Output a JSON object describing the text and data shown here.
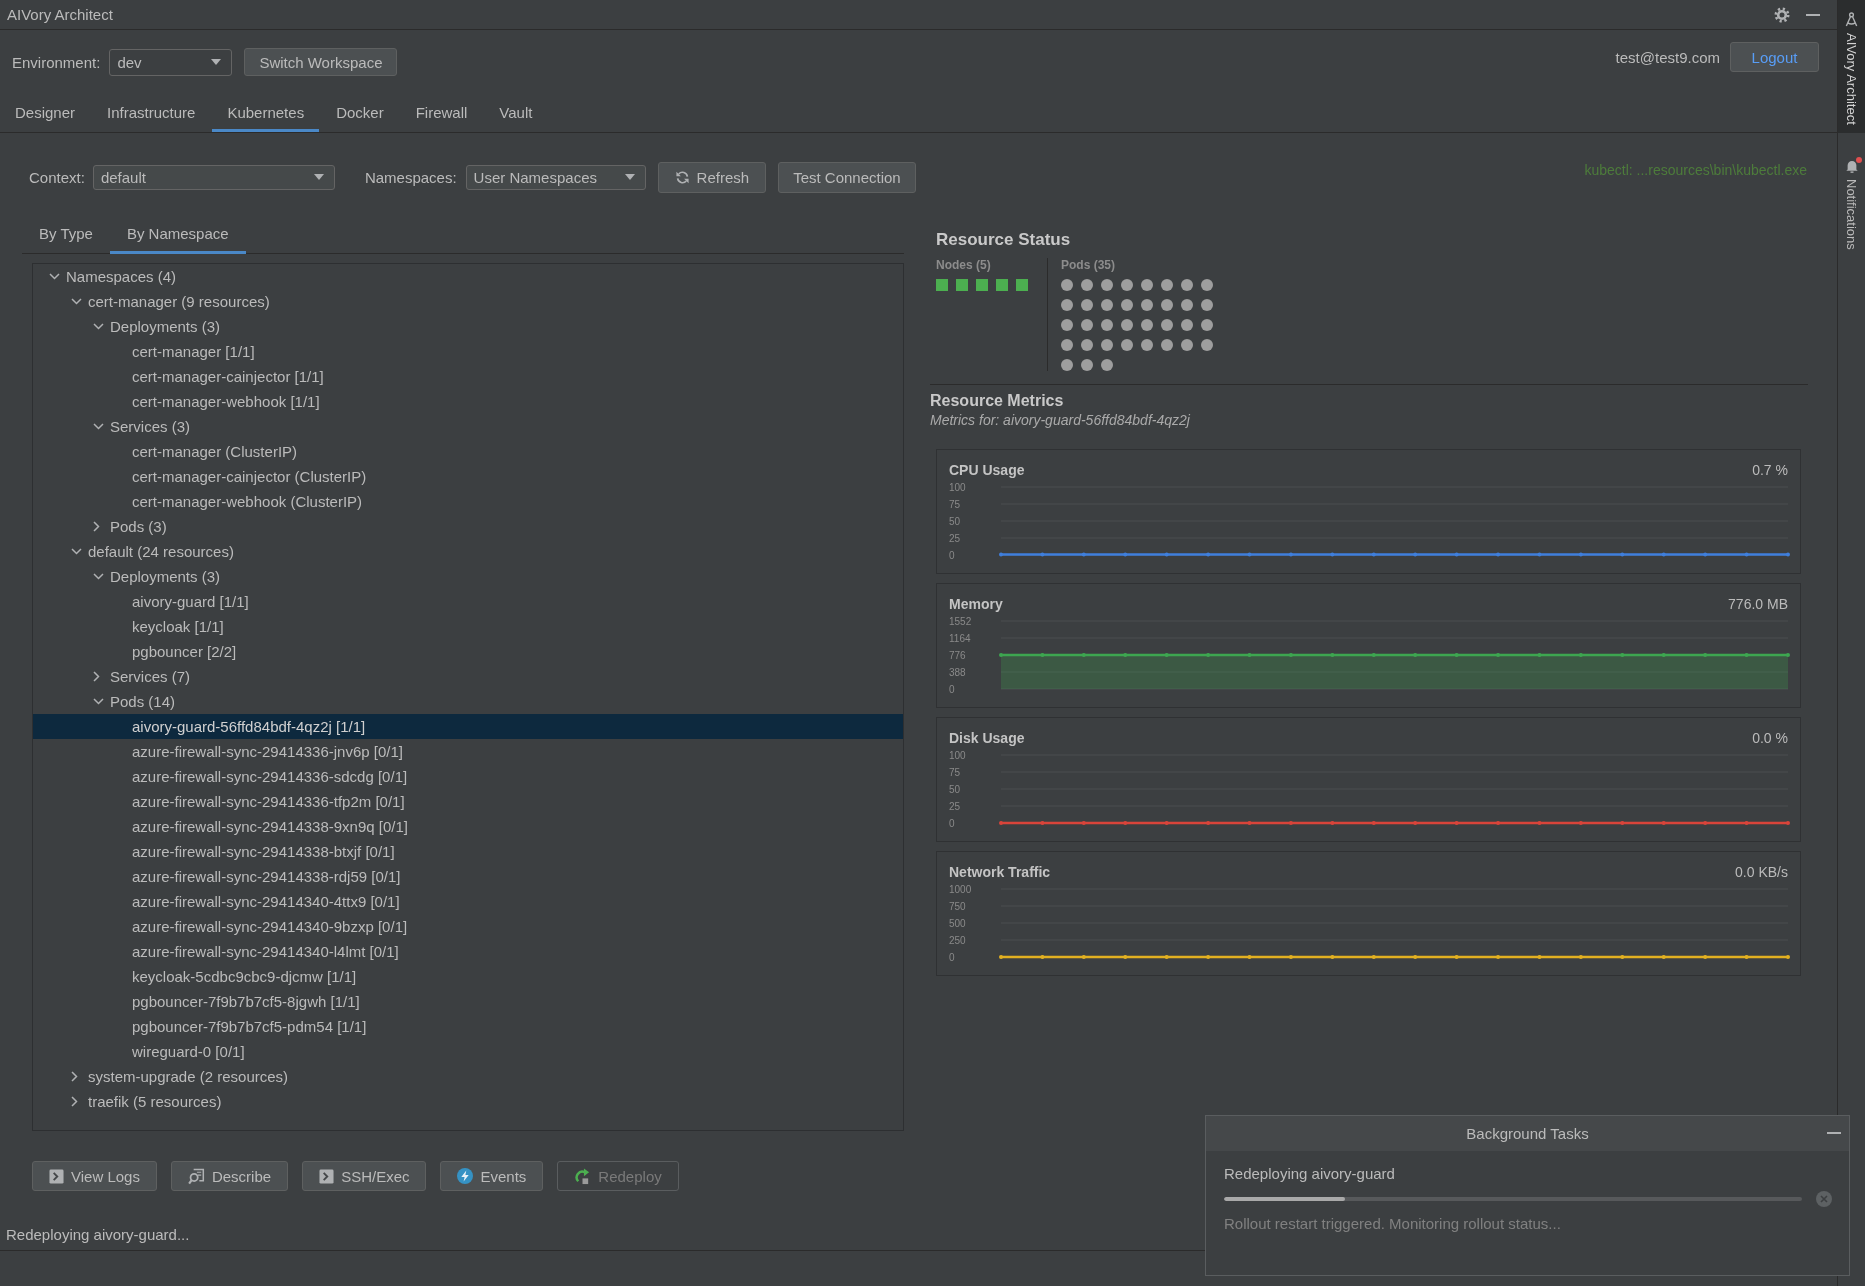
{
  "window": {
    "title": "AIVory Architect"
  },
  "header": {
    "environment_label": "Environment:",
    "environment": "dev",
    "switch_button": "Switch Workspace",
    "user": "test@test9.com",
    "logout_button": "Logout"
  },
  "tabs": [
    {
      "label": "Designer",
      "selected": false
    },
    {
      "label": "Infrastructure",
      "selected": false
    },
    {
      "label": "Kubernetes",
      "selected": true
    },
    {
      "label": "Docker",
      "selected": false
    },
    {
      "label": "Firewall",
      "selected": false
    },
    {
      "label": "Vault",
      "selected": false
    }
  ],
  "toolbar": {
    "context_label": "Context:",
    "context": "default",
    "namespaces_label": "Namespaces:",
    "namespaces": "User Namespaces",
    "refresh_button": "Refresh",
    "test_button": "Test Connection",
    "kubectl_path": "kubectl: ...resources\\bin\\kubectl.exe"
  },
  "view_tabs": [
    {
      "label": "By Type",
      "selected": false
    },
    {
      "label": "By Namespace",
      "selected": true
    }
  ],
  "tree": [
    {
      "label": "Namespaces (4)",
      "expanded": true,
      "selected": false,
      "children": [
        {
          "label": "cert-manager (9 resources)",
          "expanded": true,
          "selected": false,
          "children": [
            {
              "label": "Deployments (3)",
              "expanded": true,
              "selected": false,
              "children": [
                {
                  "label": "cert-manager [1/1]",
                  "selected": false
                },
                {
                  "label": "cert-manager-cainjector [1/1]",
                  "selected": false
                },
                {
                  "label": "cert-manager-webhook [1/1]",
                  "selected": false
                }
              ]
            },
            {
              "label": "Services (3)",
              "expanded": true,
              "selected": false,
              "children": [
                {
                  "label": "cert-manager (ClusterIP)",
                  "selected": false
                },
                {
                  "label": "cert-manager-cainjector (ClusterIP)",
                  "selected": false
                },
                {
                  "label": "cert-manager-webhook (ClusterIP)",
                  "selected": false
                }
              ]
            },
            {
              "label": "Pods (3)",
              "expanded": false,
              "selected": false
            }
          ]
        },
        {
          "label": "default (24 resources)",
          "expanded": true,
          "selected": false,
          "children": [
            {
              "label": "Deployments (3)",
              "expanded": true,
              "selected": false,
              "children": [
                {
                  "label": "aivory-guard [1/1]",
                  "selected": false
                },
                {
                  "label": "keycloak [1/1]",
                  "selected": false
                },
                {
                  "label": "pgbouncer [2/2]",
                  "selected": false
                }
              ]
            },
            {
              "label": "Services (7)",
              "expanded": false,
              "selected": false
            },
            {
              "label": "Pods (14)",
              "expanded": true,
              "selected": false,
              "children": [
                {
                  "label": "aivory-guard-56ffd84bdf-4qz2j [1/1]",
                  "selected": true
                },
                {
                  "label": "azure-firewall-sync-29414336-jnv6p [0/1]",
                  "selected": false
                },
                {
                  "label": "azure-firewall-sync-29414336-sdcdg [0/1]",
                  "selected": false
                },
                {
                  "label": "azure-firewall-sync-29414336-tfp2m [0/1]",
                  "selected": false
                },
                {
                  "label": "azure-firewall-sync-29414338-9xn9q [0/1]",
                  "selected": false
                },
                {
                  "label": "azure-firewall-sync-29414338-btxjf [0/1]",
                  "selected": false
                },
                {
                  "label": "azure-firewall-sync-29414338-rdj59 [0/1]",
                  "selected": false
                },
                {
                  "label": "azure-firewall-sync-29414340-4ttx9 [0/1]",
                  "selected": false
                },
                {
                  "label": "azure-firewall-sync-29414340-9bzxp [0/1]",
                  "selected": false
                },
                {
                  "label": "azure-firewall-sync-29414340-l4lmt [0/1]",
                  "selected": false
                },
                {
                  "label": "keycloak-5cdbc9cbc9-djcmw [1/1]",
                  "selected": false
                },
                {
                  "label": "pgbouncer-7f9b7b7cf5-8jgwh [1/1]",
                  "selected": false
                },
                {
                  "label": "pgbouncer-7f9b7b7cf5-pdm54 [1/1]",
                  "selected": false
                },
                {
                  "label": "wireguard-0 [0/1]",
                  "selected": false
                }
              ]
            }
          ]
        },
        {
          "label": "system-upgrade (2 resources)",
          "expanded": false,
          "selected": false
        },
        {
          "label": "traefik (5 resources)",
          "expanded": false,
          "selected": false
        }
      ]
    }
  ],
  "actions": [
    {
      "kind": "logs",
      "label": "View Logs",
      "disabled": false
    },
    {
      "kind": "describe",
      "label": "Describe",
      "disabled": false
    },
    {
      "kind": "exec",
      "label": "SSH/Exec",
      "disabled": false
    },
    {
      "kind": "events",
      "label": "Events",
      "disabled": false
    },
    {
      "kind": "redeploy",
      "label": "Redeploy",
      "disabled": true
    }
  ],
  "status_text": "Redeploying aivory-guard...",
  "resource_status": {
    "title": "Resource Status",
    "nodes": {
      "label": "Nodes (5)",
      "items": [
        {
          "color": "#4caf50"
        },
        {
          "color": "#4caf50"
        },
        {
          "color": "#4caf50"
        },
        {
          "color": "#4caf50"
        },
        {
          "color": "#4caf50"
        }
      ]
    },
    "pods": {
      "label": "Pods (35)",
      "items": [
        {
          "color": "#9e9e9e"
        },
        {
          "color": "#9e9e9e"
        },
        {
          "color": "#9e9e9e"
        },
        {
          "color": "#9e9e9e"
        },
        {
          "color": "#9e9e9e"
        },
        {
          "color": "#9e9e9e"
        },
        {
          "color": "#9e9e9e"
        },
        {
          "color": "#9e9e9e"
        },
        {
          "color": "#9e9e9e"
        },
        {
          "color": "#9e9e9e"
        },
        {
          "color": "#9e9e9e"
        },
        {
          "color": "#9e9e9e"
        },
        {
          "color": "#9e9e9e"
        },
        {
          "color": "#9e9e9e"
        },
        {
          "color": "#9e9e9e"
        },
        {
          "color": "#9e9e9e"
        },
        {
          "color": "#9e9e9e"
        },
        {
          "color": "#9e9e9e"
        },
        {
          "color": "#9e9e9e"
        },
        {
          "color": "#9e9e9e"
        },
        {
          "color": "#9e9e9e"
        },
        {
          "color": "#9e9e9e"
        },
        {
          "color": "#9e9e9e"
        },
        {
          "color": "#9e9e9e"
        },
        {
          "color": "#9e9e9e"
        },
        {
          "color": "#9e9e9e"
        },
        {
          "color": "#9e9e9e"
        },
        {
          "color": "#9e9e9e"
        },
        {
          "color": "#9e9e9e"
        },
        {
          "color": "#9e9e9e"
        },
        {
          "color": "#9e9e9e"
        },
        {
          "color": "#9e9e9e"
        },
        {
          "color": "#9e9e9e"
        },
        {
          "color": "#9e9e9e"
        },
        {
          "color": "#9e9e9e"
        }
      ]
    }
  },
  "resource_metrics": {
    "title": "Resource Metrics",
    "subtitle": "Metrics for: aivory-guard-56ffd84bdf-4qz2j",
    "charts": [
      {
        "reading": "0.7 %",
        "chart_data": {
          "type": "line",
          "title": "CPU Usage",
          "grid": true,
          "ylim": [
            0,
            100
          ],
          "yticks": [
            0,
            25,
            50,
            75,
            100
          ],
          "series": [
            {
              "color": "#3f7fdc",
              "values": [
                0.7,
                0.7,
                0.7,
                0.7,
                0.7,
                0.7,
                0.7,
                0.7,
                0.7,
                0.7,
                0.7,
                0.7,
                0.7,
                0.7,
                0.7,
                0.7,
                0.7,
                0.7,
                0.7,
                0.7
              ]
            }
          ]
        }
      },
      {
        "reading": "776.0 MB",
        "chart_data": {
          "type": "area",
          "title": "Memory",
          "grid": true,
          "ylim": [
            0,
            1552
          ],
          "yticks": [
            0,
            388,
            776,
            1164,
            1552
          ],
          "series": [
            {
              "color": "#3da650",
              "values": [
                776,
                776,
                776,
                776,
                776,
                776,
                776,
                776,
                776,
                776,
                776,
                776,
                776,
                776,
                776,
                776,
                776,
                776,
                776,
                776
              ]
            }
          ]
        }
      },
      {
        "reading": "0.0 %",
        "chart_data": {
          "type": "line",
          "title": "Disk Usage",
          "grid": true,
          "ylim": [
            0,
            100
          ],
          "yticks": [
            0,
            25,
            50,
            75,
            100
          ],
          "series": [
            {
              "color": "#d9443a",
              "values": [
                0,
                0,
                0,
                0,
                0,
                0,
                0,
                0,
                0,
                0,
                0,
                0,
                0,
                0,
                0,
                0,
                0,
                0,
                0,
                0
              ]
            }
          ]
        }
      },
      {
        "reading": "0.0 KB/s",
        "chart_data": {
          "type": "line",
          "title": "Network Traffic",
          "grid": true,
          "ylim": [
            0,
            1000
          ],
          "yticks": [
            0,
            250,
            500,
            750,
            1000
          ],
          "series": [
            {
              "color": "#e2b021",
              "values": [
                0,
                0,
                0,
                0,
                0,
                0,
                0,
                0,
                0,
                0,
                0,
                0,
                0,
                0,
                0,
                0,
                0,
                0,
                0,
                0
              ]
            }
          ]
        }
      }
    ]
  },
  "background_tasks": {
    "title": "Background Tasks",
    "tasks": [
      {
        "title": "Redeploying aivory-guard",
        "level": 0.21,
        "message": "Rollout restart triggered. Monitoring rollout status..."
      }
    ]
  },
  "side_strip": [
    {
      "kind": "app",
      "label": "AIVory Architect",
      "selected": true,
      "badge": false
    },
    {
      "kind": "notifications",
      "label": "Notifications",
      "selected": false,
      "badge": true
    }
  ]
}
